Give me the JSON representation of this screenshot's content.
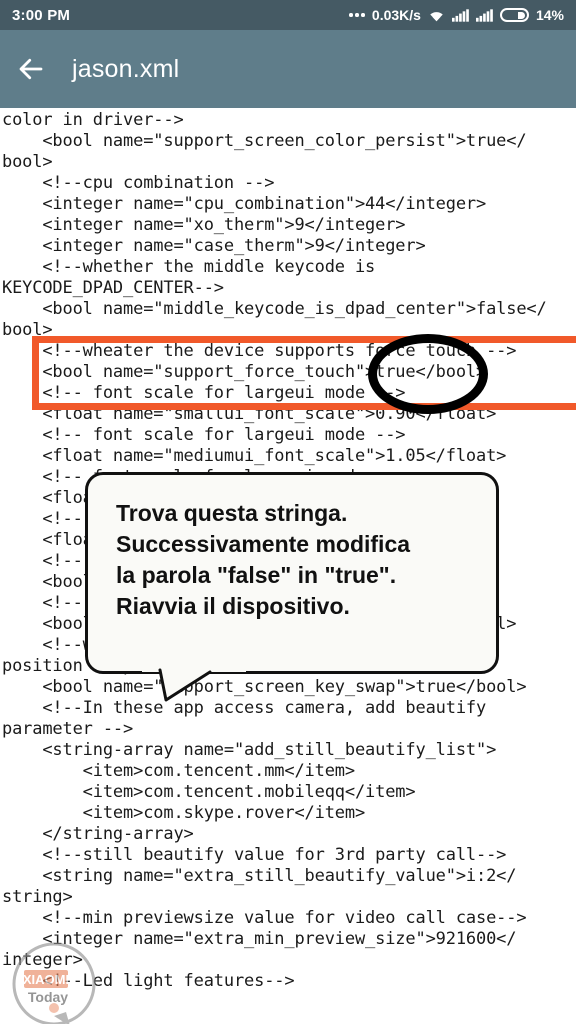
{
  "statusbar": {
    "time": "3:00 PM",
    "network_speed": "0.03K/s",
    "battery_percent": "14%",
    "icons": [
      "more-dots-icon",
      "wifi-icon",
      "signal-icon",
      "signal-icon",
      "battery-icon"
    ]
  },
  "appbar": {
    "back_icon": "back-arrow-icon",
    "title": "jason.xml"
  },
  "editor": {
    "content": "color in driver-->\n    <bool name=\"support_screen_color_persist\">true</\nbool>\n    <!--cpu combination -->\n    <integer name=\"cpu_combination\">44</integer>\n    <integer name=\"xo_therm\">9</integer>\n    <integer name=\"case_therm\">9</integer>\n    <!--whether the middle keycode is\nKEYCODE_DPAD_CENTER-->\n    <bool name=\"middle_keycode_is_dpad_center\">false</\nbool>\n    <!--wheater the device supports force touch -->\n    <bool name=\"support_force_touch\">true</bool>\n    <!-- font scale for largeui mode -->\n    <float name=\"smallui_font_scale\">0.90</float>\n    <!-- font scale for largeui mode -->\n    <float name=\"mediumui_font_scale\">1.05</float>\n    <!-- font scale for largeui mode -->\n    <float name=\"largeui_font_scale\">1.15</float>\n    <!-- font scale for largeui mode -->\n    <float name=\"hugeui_font_scale\">1.30</float>\n    <!-- support screen key -->\n    <bool name=\"support_screen_key\">true</bool>\n    <!-- support screen buttons -->\n    <bool name=\"support_screen_buttons\">true</bool>\n    <!--whether the device supports screen key\nposition swap-->\n    <bool name=\"support_screen_key_swap\">true</bool>\n    <!--In these app access camera, add beautify\nparameter -->\n    <string-array name=\"add_still_beautify_list\">\n        <item>com.tencent.mm</item>\n        <item>com.tencent.mobileqq</item>\n        <item>com.skype.rover</item>\n    </string-array>\n    <!--still beautify value for 3rd party call-->\n    <string name=\"extra_still_beautify_value\">i:2</\nstring>\n    <!--min previewsize value for video call case-->\n    <integer name=\"extra_min_preview_size\">921600</\ninteger>\n    <!--Led light features-->"
  },
  "annotations": {
    "highlight_box_color": "#f1592a",
    "ellipse_color": "#000000",
    "callout_text": "Trova questa stringa.\nSuccessivamente modifica\nla parola \"false\" in \"true\".\nRiavvia il dispositivo.",
    "callout_bg": "#fafaf7"
  },
  "watermark": {
    "brand": "XIAOMI",
    "sub": "Today",
    "accent": "#e8845c"
  }
}
